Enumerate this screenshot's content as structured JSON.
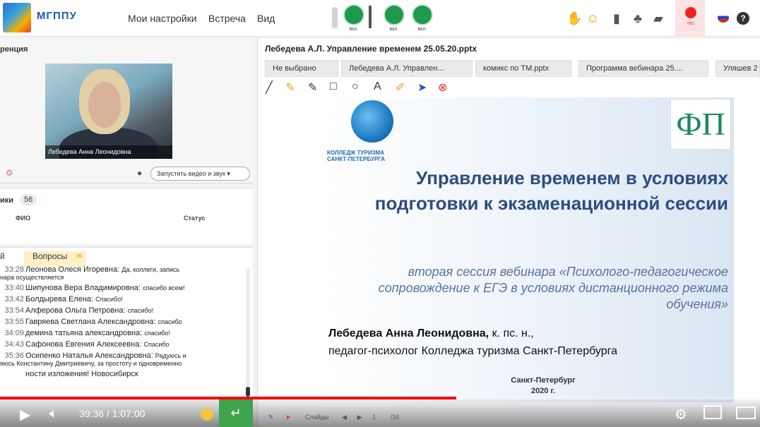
{
  "topbar": {
    "brand": "МГППУ",
    "menu": [
      "Мои настройки",
      "Встреча",
      "Вид"
    ],
    "media_labels": [
      "вкл.",
      "вкл.",
      "вкл."
    ],
    "rec_label": "rec",
    "help": "?"
  },
  "left": {
    "conference_title": "ренция",
    "video_name": "Лебедева Анна Леонидовна",
    "start_button": "Запустить видео и звук",
    "participants_title": "ики",
    "participants_count": "56",
    "col_name": "ФИО",
    "col_status": "Статус"
  },
  "chat": {
    "tab_chat": "й",
    "tab_questions": "Вопросы",
    "messages": [
      {
        "time": "33:28",
        "name": "Леонова Олеся Игоревна:",
        "text": "Да, коллеги, запись",
        "extra": "нара осуществляется"
      },
      {
        "time": "33:40",
        "name": "Шипунова Вера  Владимировна:",
        "text": "спасибо всем!",
        "extra": ""
      },
      {
        "time": "33:42",
        "name": "Болдырева Елена:",
        "text": "Спасибо!",
        "extra": ""
      },
      {
        "time": "33:54",
        "name": "Алферова Ольга  Петровна:",
        "text": "спасибо!",
        "extra": ""
      },
      {
        "time": "33:55",
        "name": "Гавряева Светлана  Александровна:",
        "text": "спасибо",
        "extra": ""
      },
      {
        "time": "34:09",
        "name": "демина татьяна  александровна:",
        "text": "спасибо!",
        "extra": ""
      },
      {
        "time": "34:43",
        "name": "Сафонова Евгения  Алексеевна:",
        "text": "Спасибо",
        "extra": ""
      },
      {
        "time": "35:36",
        "name": "Осипенко Наталья  Александровна:",
        "text": "Радуюсь и",
        "extra": "яюсь Константину Дмитриевичу, за простоту  и одновременно"
      },
      {
        "time": "",
        "name": "ности изложения! Новосибирск",
        "text": "",
        "extra": ""
      }
    ]
  },
  "presentation": {
    "title": "Лебедева А.Л. Управление временем 25.05.20.pptx",
    "tabs": [
      "Не выбрано",
      "Лебедева А.Л. Управлен...",
      "комикс по ТМ.pptx",
      "Программа вебинара 25....",
      "Уляшев 2"
    ],
    "slide": {
      "college": "КОЛЛЕДЖ ТУРИЗМА\nСАНКТ-ПЕТЕРБУРГА",
      "fi": "ФП",
      "title": "Управление временем в условиях подготовки к экзаменационной сессии",
      "subtitle": "вторая сессия вебинара «Психолого-педагогическое сопровождение к ЕГЭ в условиях дистанционного режима обучения»",
      "author": "Лебедева Анна Леонидовна,",
      "author_degree": " к. пс. н.,",
      "author_role": "педагог-психолог Колледжа туризма Санкт-Петербурга",
      "city": "Санкт-Петербург",
      "year": "2020 г."
    },
    "nav": {
      "label": "Слайды",
      "page": "1",
      "total": "/16"
    }
  },
  "player": {
    "time": "39:36 / 1:07:00",
    "progress": 0.6,
    "buffered": 0.61,
    "send_icon": "↵"
  },
  "colors": {
    "accent": "#1f9a4c",
    "brand": "#1c59b5",
    "progress": "#ff0000"
  }
}
